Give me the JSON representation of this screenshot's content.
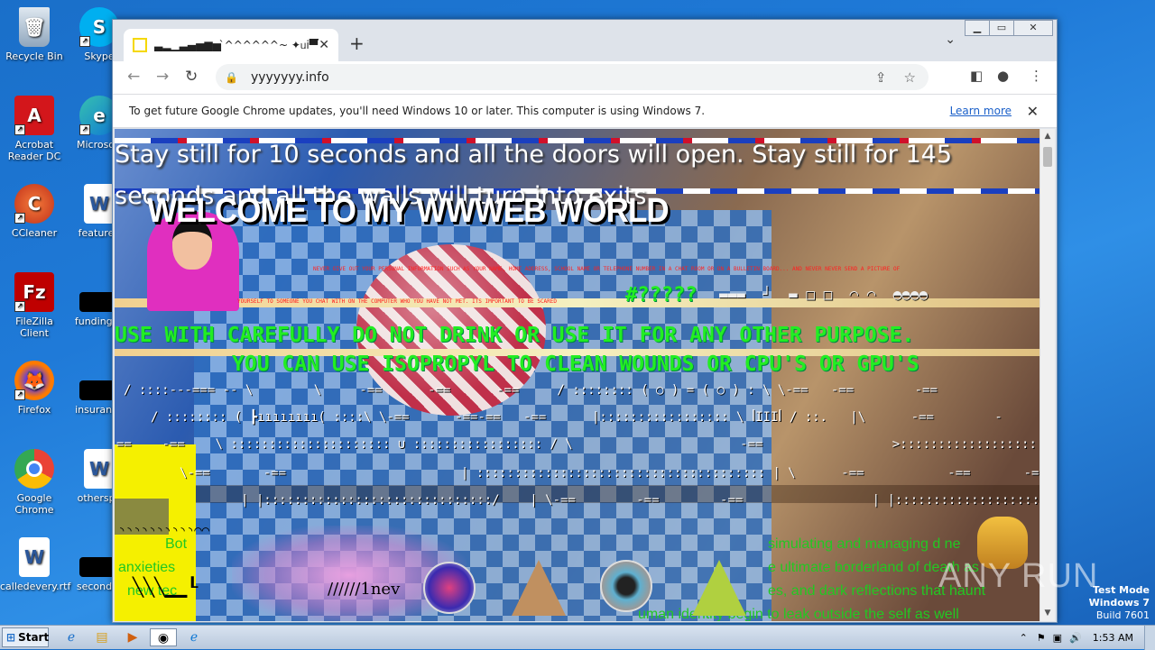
{
  "desktop": {
    "icons": [
      {
        "label": "Recycle Bin",
        "icon": "recycle-bin-icon",
        "color": "#9fb8d0"
      },
      {
        "label": "Skype",
        "icon": "skype-icon",
        "color": "#00aff0"
      },
      {
        "label": "Acrobat Reader DC",
        "icon": "acrobat-icon",
        "color": "#d3161b"
      },
      {
        "label": "Microsoft",
        "icon": "edge-icon",
        "color": "#0f78d4"
      },
      {
        "label": "CCleaner",
        "icon": "ccleaner-icon",
        "color": "#e44a2a"
      },
      {
        "label": "featured",
        "icon": "word-doc-icon",
        "color": "#2b579a"
      },
      {
        "label": "FileZilla Client",
        "icon": "filezilla-icon",
        "color": "#bf0000"
      },
      {
        "label": "fundingse",
        "icon": "black-file-icon",
        "color": "#000000"
      },
      {
        "label": "Firefox",
        "icon": "firefox-icon",
        "color": "#ff7a00"
      },
      {
        "label": "insurance",
        "icon": "black-file-icon",
        "color": "#000000"
      },
      {
        "label": "Google Chrome",
        "icon": "chrome-icon",
        "color": "#34a853"
      },
      {
        "label": "otherspo",
        "icon": "word-doc-icon",
        "color": "#2b579a"
      },
      {
        "label": "calledevery.rtf",
        "icon": "word-doc-icon",
        "color": "#2b579a"
      },
      {
        "label": "secondto",
        "icon": "black-file-icon",
        "color": "#000000"
      }
    ]
  },
  "browser": {
    "tab_title": "▃▂▁▃▄▅▆▅ ̀^^^^^^~ ✦ᥙi▀▔┅",
    "url": "yyyyyyy.info",
    "infobar_text": "To get future Google Chrome updates, you'll need Windows 10 or later. This computer is using Windows 7.",
    "learn_more": "Learn more"
  },
  "page": {
    "main_text": "Stay still for 10 seconds and all the doors will open. Stay still for 145 seconds and all the walls will turn into exits.",
    "welcome": "WELCOME TO MY WWWEB WORLD",
    "red_line1": "NEVER GIVE OUT YOUR PERSONAL INFORMATION SUCH AS YOUR NAME, HOME ADDRESS, SCHOOL NAME OR TELEPHONE NUMBER IN A CHAT ROOM OR ON A BULLETIN BOARD... AND NEVER NEVER SEND A PICTURE OF",
    "red_line2": "YOURSELF TO SOMEONE YOU CHAT WITH ON THE COMPUTER WHO YOU HAVE NOT MET. ITS IMPORTANT TO BE SCARED",
    "green_symbols": "#?????",
    "misc_symbols": "▬▬▬  ┘  ▬ □ □  ◠ ◠  ◓◓◓◓",
    "green_warning1": "USE WITH CAREFULLY DO NOT DRINK OR USE IT FOR ANY OTHER PURPOSE.",
    "green_warning2": "YOU CAN USE ISOPROPYL TO CLEAN WOUNDS OR CPU'S OR GPU'S",
    "ascii1": "/ ::::---=== -- \\        \\     -==      -==      -==     / :::::::: ( ○ ) = ( ○ ) : \\ \\-==   -==        -==",
    "ascii2": "/ :::::::: ( ┣ıııııııı( ::::\\ \\-==      -==-==   -==      |::::::::::::::::: \\ ꟾIIIꟾ / ::.   |\\      -==        -",
    "ascii3": "==    -==    \\ ::::::::::::::::::::: ∪ ::::::::::::::::: / \\                      -==                 >::::::::::::::::::::::::::::::::<",
    "ascii4": "\\-==       -==                       | :::::::::::::::::::::::::::::::::::::: | \\      -==           -==       -==",
    "ascii5": "| |::::::::::::::::::::::::::::::/    | \\-==        -==        -==                 | |:::::::::::::::::::::::::::/ | |",
    "ascii6": "◝◝◝◝◝◝◝◝◝◝◠◠",
    "green_text1": "Bot",
    "green_text2": "anxieties",
    "green_text3": "new tec",
    "green_right1": "simulating and managing d   ne",
    "green_right2": "e ultimate borderland of death as",
    "green_right3": "es, and dark reflections that haunt",
    "green_right4": "uman identity begin to leak outside the self as well",
    "black_text": "╲╲╲▁▁┖",
    "black_text2": "//////1nev"
  },
  "taskbar": {
    "start": "Start",
    "time": "1:53 AM"
  },
  "watermark": {
    "line1": "Test Mode",
    "line2": "Windows 7",
    "line3": "Build 7601",
    "anyrun": "ANY RUN"
  }
}
